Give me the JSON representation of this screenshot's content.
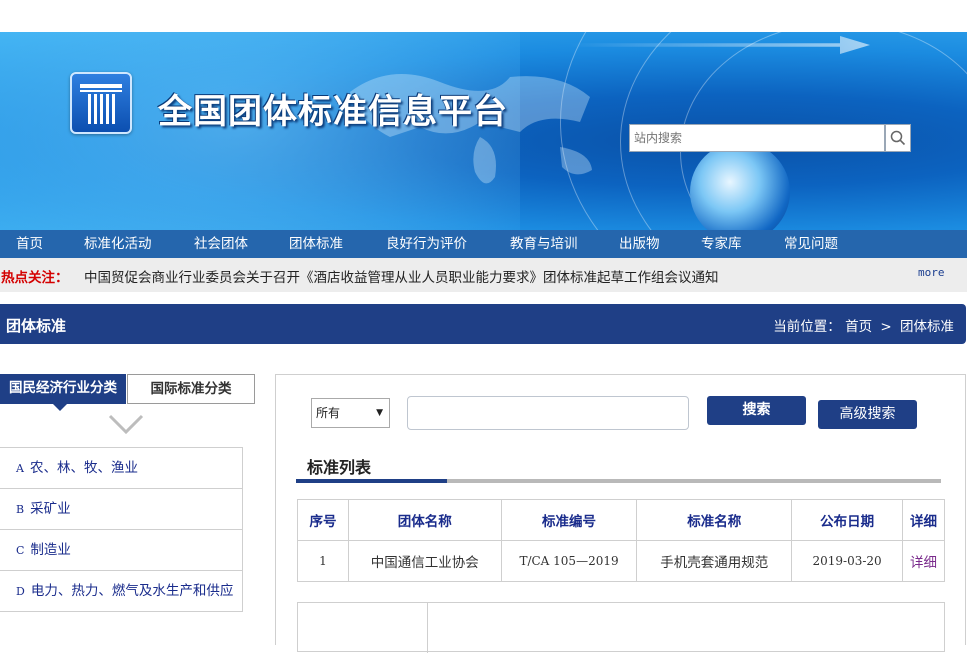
{
  "site": {
    "title": "全国团体标准信息平台"
  },
  "search": {
    "placeholder": "站内搜索"
  },
  "nav": {
    "items": [
      "首页",
      "标准化活动",
      "社会团体",
      "团体标准",
      "良好行为评价",
      "教育与培训",
      "出版物",
      "专家库",
      "常见问题"
    ]
  },
  "hot": {
    "label": "热点关注：",
    "text": "中国贸促会商业行业委员会关于召开《酒店收益管理从业人员职业能力要求》团体标准起草工作组会议通知",
    "more": "more"
  },
  "section": {
    "title": "团体标准",
    "breadcrumb_prefix": "当前位置：",
    "breadcrumb_home": "首页",
    "breadcrumb_sep": ">",
    "breadcrumb_current": "团体标准"
  },
  "category": {
    "tab_active": "国民经济行业分类",
    "tab_inactive": "国际标准分类",
    "items": [
      {
        "code": "A",
        "name": "农、林、牧、渔业"
      },
      {
        "code": "B",
        "name": "采矿业"
      },
      {
        "code": "C",
        "name": "制造业"
      },
      {
        "code": "D",
        "name": "电力、热力、燃气及水生产和供应"
      }
    ]
  },
  "filter": {
    "scope": "所有",
    "search_label": "搜索",
    "advanced_label": "高级搜索"
  },
  "list": {
    "title": "标准列表",
    "columns": [
      "序号",
      "团体名称",
      "标准编号",
      "标准名称",
      "公布日期",
      "详细"
    ],
    "rows": [
      [
        "1",
        "中国通信工业协会",
        "T/CA 105—2019",
        "手机壳套通用规范",
        "2019-03-20",
        "详细"
      ]
    ]
  },
  "colors": {
    "nav_bg": "#2566ad",
    "section_bg": "#1f3f86",
    "hot_label": "#d40000",
    "link": "#1a2c8c"
  }
}
